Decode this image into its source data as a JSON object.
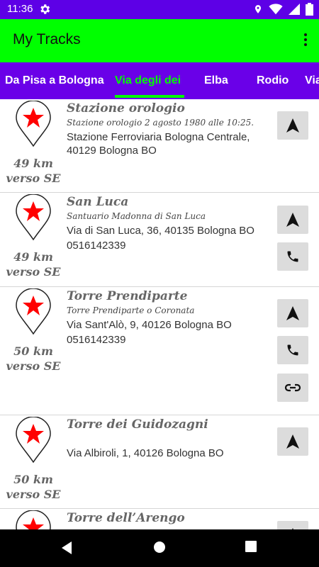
{
  "status_bar": {
    "time": "11:36",
    "icons": [
      "gear-icon",
      "location-icon",
      "wifi-icon",
      "signal-icon",
      "battery-icon"
    ]
  },
  "app_bar": {
    "title": "My Tracks",
    "menu_icon": "more-vert-icon",
    "background": "#00ff00"
  },
  "tabs": [
    {
      "label": "Da Pisa a Bologna",
      "active": false
    },
    {
      "label": "Via degli dei",
      "active": true
    },
    {
      "label": "Elba",
      "active": false
    },
    {
      "label": "Rodio",
      "active": false
    },
    {
      "label": "Via",
      "active": false
    }
  ],
  "colors": {
    "tab_bar": "#6a00e8",
    "status_bar": "#5d00e6",
    "accent": "#00ff00",
    "pin_star": "#ff0000"
  },
  "places": [
    {
      "name": "Stazione orologio",
      "subtitle": "Stazione orologio 2 agosto 1980 alle 10:25.",
      "address_line1": "Stazione Ferroviaria Bologna Centrale,",
      "address_line2": "40129 Bologna BO",
      "distance": "49 km",
      "direction": "verso SE",
      "actions": [
        "navigate-icon"
      ]
    },
    {
      "name": "San Luca",
      "subtitle": "Santuario Madonna di San Luca",
      "address_line1": "Via di San Luca, 36, 40135 Bologna BO",
      "address_line2": "0516142339",
      "distance": "49 km",
      "direction": "verso SE",
      "actions": [
        "navigate-icon",
        "phone-icon"
      ]
    },
    {
      "name": "Torre Prendiparte",
      "subtitle": "Torre Prendiparte o Coronata",
      "address_line1": "Via Sant'Alò, 9, 40126 Bologna BO",
      "address_line2": "0516142339",
      "distance": "50 km",
      "direction": "verso SE",
      "actions": [
        "navigate-icon",
        "phone-icon",
        "link-icon"
      ]
    },
    {
      "name": "Torre dei Guidozagni",
      "subtitle": "",
      "address_line1": "Via Albiroli, 1, 40126 Bologna BO",
      "address_line2": "",
      "distance": "50 km",
      "direction": "verso SE",
      "actions": [
        "navigate-icon"
      ]
    },
    {
      "name": "Torre dell’Arengo",
      "subtitle": "",
      "address_line1": "",
      "address_line2": "",
      "distance": "",
      "direction": "",
      "actions": [
        "navigate-icon"
      ]
    }
  ],
  "nav_bar": {
    "buttons": [
      "back-icon",
      "home-icon",
      "recents-icon"
    ]
  }
}
